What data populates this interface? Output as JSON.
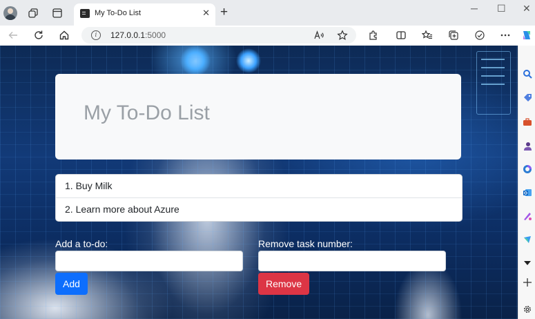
{
  "browser": {
    "tab_title": "My To-Do List",
    "tab_close": "✕",
    "new_tab": "+",
    "url_host": "127.0.0.1",
    "url_port": ":5000",
    "window_controls": [
      "─",
      "☐",
      "✕"
    ]
  },
  "page": {
    "title": "My To-Do List",
    "tasks": [
      "1. Buy Milk",
      "2. Learn more about Azure"
    ],
    "add_form": {
      "label": "Add a to-do:",
      "value": "",
      "button": "Add"
    },
    "remove_form": {
      "label": "Remove task number:",
      "value": "",
      "button": "Remove"
    }
  },
  "colors": {
    "add_button": "#0d6efd",
    "remove_button": "#dc3545",
    "jumbotron": "#f8f9fa"
  },
  "icons": {
    "toolbar": [
      "back-icon",
      "refresh-icon",
      "home-icon",
      "info-icon",
      "read-aloud-icon",
      "favorite-star-icon",
      "extensions-icon",
      "split-screen-icon",
      "favorites-icon",
      "collections-icon",
      "performance-icon",
      "more-icon",
      "copilot-icon"
    ],
    "sidebar": [
      "search-icon",
      "shopping-icon",
      "tools-icon",
      "games-icon",
      "microsoft-365-icon",
      "outlook-icon",
      "designer-icon",
      "drop-icon",
      "collapse-icon",
      "add-icon",
      "settings-icon"
    ]
  }
}
